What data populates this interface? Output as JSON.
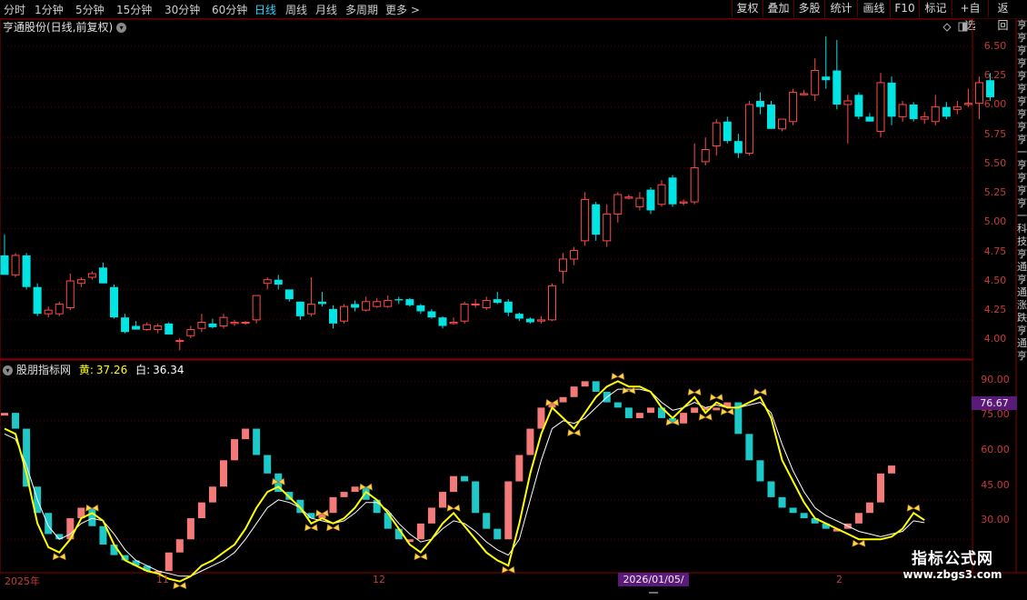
{
  "toolbar": {
    "periods": [
      "分时",
      "1分钟",
      "5分钟",
      "15分钟",
      "30分钟",
      "60分钟",
      "日线",
      "周线",
      "月线",
      "多周期",
      "更多 >"
    ],
    "active_period": "日线",
    "right_buttons": [
      "复权",
      "叠加",
      "多股",
      "统计",
      "画线",
      "F10",
      "标记",
      "+自选",
      "返回"
    ]
  },
  "stock": {
    "title": "亨通股份(日线,前复权)"
  },
  "indicator": {
    "name": "股朋指标网",
    "yellow_label": "黄:",
    "yellow_value": "37.26",
    "white_label": "白:",
    "white_value": "36.34",
    "current_box": "76.67"
  },
  "price_axis": [
    "6.50",
    "6.25",
    "6.00",
    "5.75",
    "5.50",
    "5.25",
    "5.00",
    "4.75",
    "4.50",
    "4.25",
    "4.00"
  ],
  "indicator_axis": [
    "90.00",
    "75.00",
    "60.00",
    "45.00",
    "30.00"
  ],
  "date_axis": {
    "start": "2025年",
    "nov": "11",
    "dec": "12",
    "cursor_date": "2026/01/05/一",
    "feb": "2"
  },
  "side_column": "亨亨亨亨亨亨亨亨亨亨一亨亨亨亨一 科技 亨通 亨通 涨跌 亨 通 亨",
  "watermark": {
    "line1": "指标公式网",
    "line2": "www.zbgs3.com"
  },
  "colors": {
    "up": "#ff4a4a",
    "down": "#00e4e4",
    "yellow_line": "#ffff00",
    "white_line": "#ffffff",
    "bar_up": "#f47a7a",
    "bar_down": "#1cc8c8",
    "axis": "#8a0000"
  },
  "chart_data": [
    {
      "type": "candlestick",
      "title": "亨通股份(日线,前复权)",
      "ylim": [
        3.95,
        6.7
      ],
      "ticks": [
        4.0,
        4.25,
        4.5,
        4.75,
        5.0,
        5.25,
        5.5,
        5.75,
        6.0,
        6.25,
        6.5
      ],
      "candles": [
        {
          "o": 4.78,
          "h": 4.95,
          "l": 4.62,
          "c": 4.62
        },
        {
          "o": 4.62,
          "h": 4.8,
          "l": 4.6,
          "c": 4.78
        },
        {
          "o": 4.78,
          "h": 4.8,
          "l": 4.5,
          "c": 4.52
        },
        {
          "o": 4.52,
          "h": 4.55,
          "l": 4.28,
          "c": 4.3
        },
        {
          "o": 4.3,
          "h": 4.36,
          "l": 4.27,
          "c": 4.33
        },
        {
          "o": 4.3,
          "h": 4.4,
          "l": 4.28,
          "c": 4.38
        },
        {
          "o": 4.35,
          "h": 4.63,
          "l": 4.33,
          "c": 4.57
        },
        {
          "o": 4.55,
          "h": 4.6,
          "l": 4.52,
          "c": 4.58
        },
        {
          "o": 4.6,
          "h": 4.65,
          "l": 4.58,
          "c": 4.63
        },
        {
          "o": 4.68,
          "h": 4.72,
          "l": 4.55,
          "c": 4.55
        },
        {
          "o": 4.52,
          "h": 4.54,
          "l": 4.26,
          "c": 4.27
        },
        {
          "o": 4.27,
          "h": 4.3,
          "l": 4.14,
          "c": 4.15
        },
        {
          "o": 4.2,
          "h": 4.24,
          "l": 4.17,
          "c": 4.17
        },
        {
          "o": 4.17,
          "h": 4.23,
          "l": 4.16,
          "c": 4.21
        },
        {
          "o": 4.17,
          "h": 4.22,
          "l": 4.14,
          "c": 4.2
        },
        {
          "o": 4.22,
          "h": 4.23,
          "l": 4.13,
          "c": 4.13
        },
        {
          "o": 4.08,
          "h": 4.1,
          "l": 4.0,
          "c": 4.08
        },
        {
          "o": 4.12,
          "h": 4.2,
          "l": 4.1,
          "c": 4.17
        },
        {
          "o": 4.18,
          "h": 4.3,
          "l": 4.15,
          "c": 4.23
        },
        {
          "o": 4.22,
          "h": 4.26,
          "l": 4.18,
          "c": 4.19
        },
        {
          "o": 4.2,
          "h": 4.3,
          "l": 4.18,
          "c": 4.27
        },
        {
          "o": 4.22,
          "h": 4.25,
          "l": 4.2,
          "c": 4.23
        },
        {
          "o": 4.23,
          "h": 4.24,
          "l": 4.21,
          "c": 4.23
        },
        {
          "o": 4.25,
          "h": 4.45,
          "l": 4.22,
          "c": 4.45
        },
        {
          "o": 4.55,
          "h": 4.6,
          "l": 4.5,
          "c": 4.58
        },
        {
          "o": 4.58,
          "h": 4.62,
          "l": 4.5,
          "c": 4.54
        },
        {
          "o": 4.5,
          "h": 4.5,
          "l": 4.4,
          "c": 4.42
        },
        {
          "o": 4.4,
          "h": 4.4,
          "l": 4.25,
          "c": 4.28
        },
        {
          "o": 4.3,
          "h": 4.6,
          "l": 4.28,
          "c": 4.38
        },
        {
          "o": 4.4,
          "h": 4.48,
          "l": 4.36,
          "c": 4.38
        },
        {
          "o": 4.34,
          "h": 4.37,
          "l": 4.18,
          "c": 4.22
        },
        {
          "o": 4.24,
          "h": 4.38,
          "l": 4.22,
          "c": 4.36
        },
        {
          "o": 4.38,
          "h": 4.41,
          "l": 4.32,
          "c": 4.35
        },
        {
          "o": 4.33,
          "h": 4.44,
          "l": 4.32,
          "c": 4.4
        },
        {
          "o": 4.36,
          "h": 4.43,
          "l": 4.35,
          "c": 4.4
        },
        {
          "o": 4.36,
          "h": 4.45,
          "l": 4.35,
          "c": 4.41
        },
        {
          "o": 4.42,
          "h": 4.44,
          "l": 4.38,
          "c": 4.41
        },
        {
          "o": 4.42,
          "h": 4.43,
          "l": 4.36,
          "c": 4.37
        },
        {
          "o": 4.37,
          "h": 4.38,
          "l": 4.3,
          "c": 4.32
        },
        {
          "o": 4.32,
          "h": 4.34,
          "l": 4.26,
          "c": 4.27
        },
        {
          "o": 4.27,
          "h": 4.28,
          "l": 4.18,
          "c": 4.2
        },
        {
          "o": 4.22,
          "h": 4.27,
          "l": 4.21,
          "c": 4.23
        },
        {
          "o": 4.24,
          "h": 4.4,
          "l": 4.22,
          "c": 4.38
        },
        {
          "o": 4.38,
          "h": 4.42,
          "l": 4.35,
          "c": 4.38
        },
        {
          "o": 4.35,
          "h": 4.44,
          "l": 4.33,
          "c": 4.41
        },
        {
          "o": 4.42,
          "h": 4.48,
          "l": 4.38,
          "c": 4.39
        },
        {
          "o": 4.4,
          "h": 4.42,
          "l": 4.28,
          "c": 4.31
        },
        {
          "o": 4.3,
          "h": 4.31,
          "l": 4.24,
          "c": 4.26
        },
        {
          "o": 4.26,
          "h": 4.27,
          "l": 4.22,
          "c": 4.23
        },
        {
          "o": 4.24,
          "h": 4.28,
          "l": 4.22,
          "c": 4.25
        },
        {
          "o": 4.25,
          "h": 4.55,
          "l": 4.24,
          "c": 4.53
        },
        {
          "o": 4.65,
          "h": 4.8,
          "l": 4.55,
          "c": 4.75
        },
        {
          "o": 4.75,
          "h": 4.85,
          "l": 4.7,
          "c": 4.82
        },
        {
          "o": 4.9,
          "h": 5.3,
          "l": 4.86,
          "c": 5.24
        },
        {
          "o": 5.2,
          "h": 5.22,
          "l": 4.9,
          "c": 4.95
        },
        {
          "o": 4.9,
          "h": 5.2,
          "l": 4.85,
          "c": 5.12
        },
        {
          "o": 5.12,
          "h": 5.3,
          "l": 5.05,
          "c": 5.28
        },
        {
          "o": 5.25,
          "h": 5.28,
          "l": 5.24,
          "c": 5.26
        },
        {
          "o": 5.18,
          "h": 5.3,
          "l": 5.15,
          "c": 5.25
        },
        {
          "o": 5.32,
          "h": 5.34,
          "l": 5.12,
          "c": 5.15
        },
        {
          "o": 5.2,
          "h": 5.4,
          "l": 5.18,
          "c": 5.36
        },
        {
          "o": 5.42,
          "h": 5.44,
          "l": 5.18,
          "c": 5.2
        },
        {
          "o": 5.21,
          "h": 5.24,
          "l": 5.19,
          "c": 5.22
        },
        {
          "o": 5.22,
          "h": 5.7,
          "l": 5.2,
          "c": 5.5
        },
        {
          "o": 5.55,
          "h": 5.75,
          "l": 5.52,
          "c": 5.65
        },
        {
          "o": 5.68,
          "h": 5.9,
          "l": 5.6,
          "c": 5.87
        },
        {
          "o": 5.88,
          "h": 5.92,
          "l": 5.7,
          "c": 5.72
        },
        {
          "o": 5.72,
          "h": 5.78,
          "l": 5.58,
          "c": 5.62
        },
        {
          "o": 5.62,
          "h": 6.05,
          "l": 5.6,
          "c": 6.02
        },
        {
          "o": 6.05,
          "h": 6.12,
          "l": 5.94,
          "c": 6.0
        },
        {
          "o": 6.02,
          "h": 6.05,
          "l": 5.82,
          "c": 5.82
        },
        {
          "o": 5.82,
          "h": 5.9,
          "l": 5.8,
          "c": 5.9
        },
        {
          "o": 5.88,
          "h": 6.15,
          "l": 5.85,
          "c": 6.12
        },
        {
          "o": 6.1,
          "h": 6.14,
          "l": 6.1,
          "c": 6.11
        },
        {
          "o": 6.1,
          "h": 6.4,
          "l": 6.05,
          "c": 6.3
        },
        {
          "o": 6.25,
          "h": 6.58,
          "l": 6.15,
          "c": 6.22
        },
        {
          "o": 6.3,
          "h": 6.55,
          "l": 5.98,
          "c": 6.02
        },
        {
          "o": 6.02,
          "h": 6.1,
          "l": 5.7,
          "c": 6.05
        },
        {
          "o": 6.1,
          "h": 6.12,
          "l": 5.9,
          "c": 5.92
        },
        {
          "o": 5.92,
          "h": 5.95,
          "l": 5.88,
          "c": 5.88
        },
        {
          "o": 5.8,
          "h": 6.28,
          "l": 5.75,
          "c": 6.2
        },
        {
          "o": 6.2,
          "h": 6.25,
          "l": 5.85,
          "c": 5.92
        },
        {
          "o": 5.92,
          "h": 6.05,
          "l": 5.88,
          "c": 6.02
        },
        {
          "o": 6.02,
          "h": 6.04,
          "l": 5.88,
          "c": 5.9
        },
        {
          "o": 5.9,
          "h": 5.96,
          "l": 5.86,
          "c": 5.92
        },
        {
          "o": 5.88,
          "h": 6.1,
          "l": 5.85,
          "c": 6.0
        },
        {
          "o": 6.0,
          "h": 6.04,
          "l": 5.9,
          "c": 5.92
        },
        {
          "o": 5.98,
          "h": 6.05,
          "l": 5.94,
          "c": 6.0
        },
        {
          "o": 6.02,
          "h": 6.15,
          "l": 6.0,
          "c": 6.03
        },
        {
          "o": 6.03,
          "h": 6.25,
          "l": 5.9,
          "c": 6.2
        },
        {
          "o": 6.22,
          "h": 6.28,
          "l": 6.05,
          "c": 6.08
        }
      ]
    },
    {
      "type": "bar",
      "title": "股朋指标网",
      "ylim": [
        18,
        96
      ],
      "ticks": [
        30,
        45,
        60,
        75,
        90
      ],
      "series": [
        {
          "name": "黄",
          "values": [
            72,
            70,
            55,
            36,
            27,
            25,
            30,
            38,
            40,
            37,
            28,
            22,
            20,
            18,
            17,
            15,
            14,
            16,
            20,
            22,
            25,
            28,
            34,
            42,
            48,
            50,
            46,
            42,
            36,
            38,
            36,
            38,
            42,
            48,
            45,
            40,
            34,
            28,
            25,
            30,
            36,
            40,
            35,
            30,
            25,
            22,
            20,
            36,
            55,
            70,
            80,
            76,
            72,
            78,
            84,
            88,
            90,
            88,
            88,
            86,
            80,
            76,
            80,
            84,
            78,
            82,
            80,
            80,
            82,
            84,
            76,
            60,
            52,
            44,
            38,
            36,
            34,
            32,
            30,
            30,
            30,
            31,
            34,
            40,
            37.26
          ]
        },
        {
          "name": "白",
          "values": [
            70,
            68,
            58,
            45,
            35,
            30,
            32,
            36,
            38,
            37,
            32,
            26,
            22,
            20,
            18,
            17,
            16,
            16,
            18,
            20,
            22,
            25,
            30,
            36,
            42,
            45,
            44,
            42,
            38,
            37,
            36,
            37,
            40,
            44,
            44,
            41,
            36,
            32,
            29,
            30,
            34,
            37,
            36,
            33,
            29,
            26,
            24,
            30,
            45,
            60,
            72,
            75,
            74,
            76,
            80,
            84,
            87,
            87,
            87,
            86,
            82,
            79,
            80,
            82,
            80,
            81,
            80,
            80,
            81,
            82,
            78,
            66,
            56,
            48,
            42,
            39,
            37,
            35,
            33,
            32,
            31,
            32,
            33,
            37,
            36.34
          ]
        },
        {
          "name": "bars",
          "values": [
            78,
            72,
            50,
            40,
            32,
            30,
            38,
            42,
            35,
            28,
            24,
            22,
            20,
            18,
            18,
            25,
            30,
            38,
            44,
            50,
            60,
            68,
            72,
            62,
            55,
            48,
            45,
            40,
            38,
            40,
            46,
            48,
            50,
            45,
            40,
            34,
            30,
            30,
            36,
            42,
            48,
            54,
            52,
            40,
            34,
            30,
            52,
            62,
            72,
            80,
            82,
            84,
            88,
            90,
            86,
            82,
            80,
            76,
            78,
            80,
            76,
            74,
            78,
            80,
            80,
            80,
            82,
            70,
            60,
            52,
            46,
            42,
            40,
            38,
            36,
            34,
            34,
            36,
            40,
            44,
            55,
            58
          ]
        }
      ]
    }
  ]
}
